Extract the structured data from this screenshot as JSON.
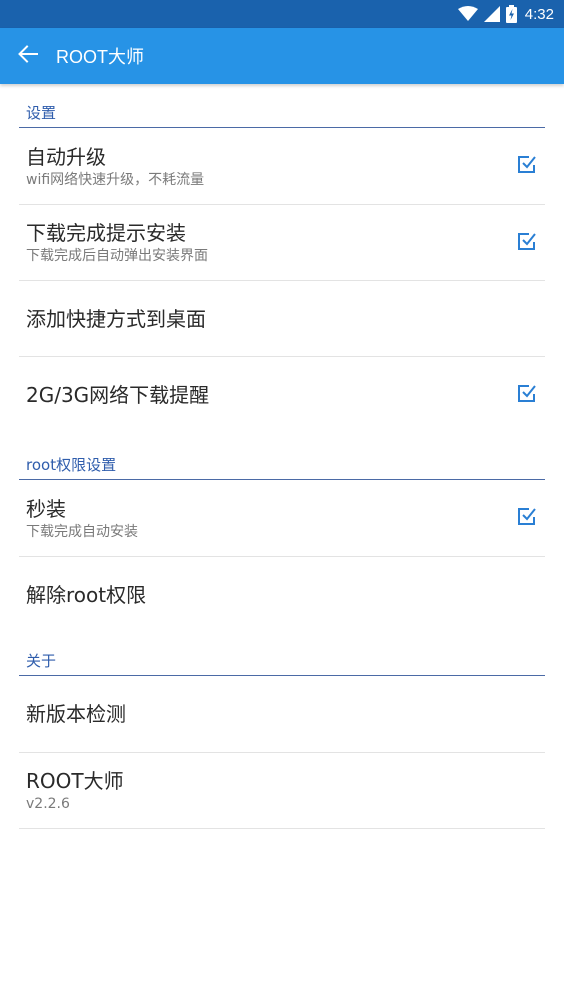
{
  "status_bar": {
    "time": "4:32",
    "icons": [
      "wifi-icon",
      "signal-icon",
      "battery-charging-icon"
    ]
  },
  "app_bar": {
    "title": "ROOT大师",
    "back_icon": "arrow-left-icon"
  },
  "colors": {
    "status_bar": "#1a62ad",
    "app_bar": "#2793e6",
    "section_header": "#2f5dac",
    "checkbox": "#2a7fd4"
  },
  "sections": [
    {
      "header": "设置",
      "items": [
        {
          "title": "自动升级",
          "subtitle": "wifi网络快速升级，不耗流量",
          "checked": true
        },
        {
          "title": "下载完成提示安装",
          "subtitle": "下载完成后自动弹出安装界面",
          "checked": true
        },
        {
          "title": "添加快捷方式到桌面"
        },
        {
          "title": "2G/3G网络下载提醒",
          "checked": true
        }
      ]
    },
    {
      "header": "root权限设置",
      "items": [
        {
          "title": "秒装",
          "subtitle": "下载完成自动安装",
          "checked": true
        },
        {
          "title": "解除root权限"
        }
      ]
    },
    {
      "header": "关于",
      "items": [
        {
          "title": "新版本检测"
        },
        {
          "title": "ROOT大师",
          "subtitle": "v2.2.6"
        }
      ]
    }
  ]
}
